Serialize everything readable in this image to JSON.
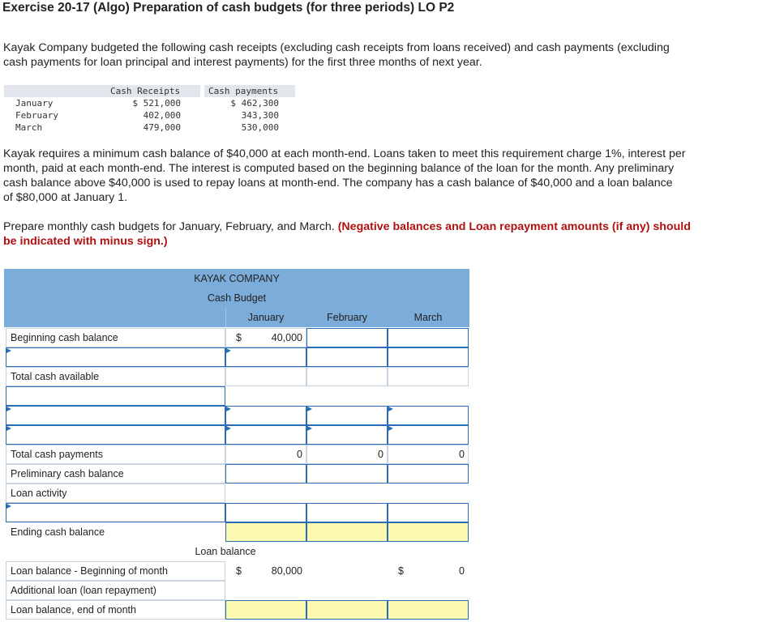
{
  "title": "Exercise 20-17 (Algo) Preparation of cash budgets (for three periods) LO P2",
  "intro_line1": "Kayak Company budgeted the following cash receipts (excluding cash receipts from loans received) and cash payments (excluding",
  "intro_line2": "cash payments for loan principal and interest payments) for the first three months of next year.",
  "receipts_table": {
    "col1": "Cash Receipts",
    "col2": "Cash payments",
    "rows": [
      {
        "month": "January",
        "receipts": "$ 521,000",
        "payments": "$ 462,300"
      },
      {
        "month": "February",
        "receipts": "402,000",
        "payments": "343,300"
      },
      {
        "month": "March",
        "receipts": "479,000",
        "payments": "530,000"
      }
    ]
  },
  "req_line1": "Kayak requires a minimum cash balance of $40,000 at each month-end. Loans taken to meet this requirement charge 1%, interest per",
  "req_line2": "month, paid at each month-end. The interest is computed based on the beginning balance of the loan for the month. Any preliminary",
  "req_line3": "cash balance above $40,000 is used to repay loans at month-end. The company has a cash balance of  $40,000 and a loan balance",
  "req_line4": "of $80,000 at January 1.",
  "instr_plain": "Prepare monthly cash budgets for January, February, and March.",
  "instr_red1": "(Negative balances and Loan repayment amounts (if any) should",
  "instr_red2": "be indicated with minus sign.)",
  "budget": {
    "company": "KAYAK COMPANY",
    "name": "Cash Budget",
    "months": [
      "January",
      "February",
      "March"
    ],
    "labels": {
      "beginning": "Beginning cash balance",
      "total_available": "Total cash available",
      "total_payments": "Total cash payments",
      "preliminary": "Preliminary cash balance",
      "loan_activity": "Loan activity",
      "ending": "Ending cash balance"
    },
    "jan_dollar": "$",
    "jan_begin": "40,000",
    "total_payments_values": [
      "0",
      "0",
      "0"
    ],
    "loan_section": "Loan balance",
    "loan_labels": {
      "beginning": "Loan balance - Beginning of month",
      "additional": "Additional loan (loan repayment)",
      "end": "Loan balance, end of month"
    },
    "loan_jan_dollar": "$",
    "loan_jan_begin": "80,000",
    "loan_mar_dollar": "$",
    "loan_mar_begin": "0"
  }
}
